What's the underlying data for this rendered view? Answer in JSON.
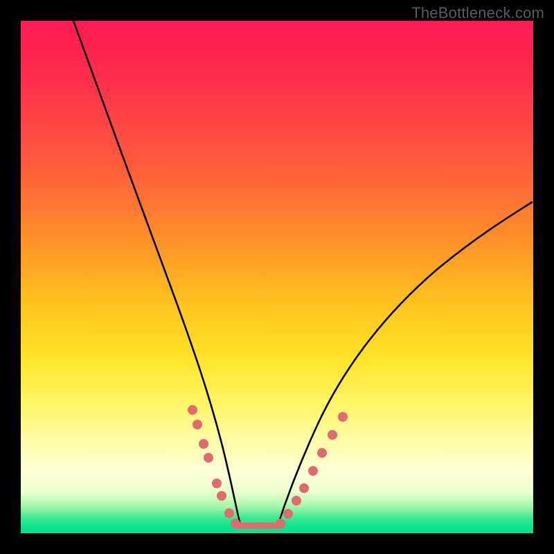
{
  "watermark": {
    "text": "TheBottleneck.com"
  },
  "chart_data": {
    "type": "line",
    "title": "",
    "xlabel": "",
    "ylabel": "",
    "xlim": [
      0,
      100
    ],
    "ylim": [
      0,
      100
    ],
    "grid": false,
    "legend": false,
    "curves": [
      {
        "name": "left",
        "x": [
          0,
          5,
          10,
          15,
          20,
          25,
          28,
          30,
          32,
          34,
          36,
          38,
          40,
          41,
          42
        ],
        "y": [
          100,
          90,
          79,
          67,
          55,
          42,
          33,
          27,
          21,
          16,
          11,
          7,
          3,
          1.5,
          0.5
        ]
      },
      {
        "name": "bottom",
        "x": [
          42,
          44,
          46,
          48,
          50
        ],
        "y": [
          0.5,
          0.3,
          0.3,
          0.3,
          0.5
        ]
      },
      {
        "name": "right",
        "x": [
          50,
          52,
          55,
          58,
          62,
          67,
          73,
          80,
          88,
          96,
          100
        ],
        "y": [
          0.5,
          2,
          6,
          11,
          18,
          26,
          34,
          42,
          49,
          54,
          56
        ]
      }
    ],
    "markers_left": {
      "name": "left-series-points",
      "color": "#e06a6d",
      "points": [
        {
          "x": 33.2,
          "y": 24.0
        },
        {
          "x": 34.2,
          "y": 21.0
        },
        {
          "x": 35.5,
          "y": 17.5
        },
        {
          "x": 36.4,
          "y": 15.0
        },
        {
          "x": 38.0,
          "y": 10.0
        },
        {
          "x": 39.0,
          "y": 7.5
        },
        {
          "x": 40.5,
          "y": 4.0
        },
        {
          "x": 41.6,
          "y": 1.8
        }
      ]
    },
    "markers_right": {
      "name": "right-series-points",
      "color": "#e06a6d",
      "points": [
        {
          "x": 50.5,
          "y": 1.5
        },
        {
          "x": 52.0,
          "y": 3.5
        },
        {
          "x": 53.5,
          "y": 6.0
        },
        {
          "x": 55.0,
          "y": 8.5
        },
        {
          "x": 56.8,
          "y": 12.0
        },
        {
          "x": 58.5,
          "y": 15.5
        },
        {
          "x": 60.5,
          "y": 19.0
        },
        {
          "x": 62.5,
          "y": 22.5
        }
      ]
    },
    "marker_bridge": {
      "name": "bottom-bridge",
      "color": "#e06a6d",
      "x": [
        41.6,
        50.5
      ],
      "y": [
        1.4,
        1.4
      ],
      "stroke_width": 8
    },
    "gradient_stops": [
      {
        "pos": 0.0,
        "color": "#ff1a52"
      },
      {
        "pos": 0.28,
        "color": "#ff5a3c"
      },
      {
        "pos": 0.55,
        "color": "#ffc21e"
      },
      {
        "pos": 0.82,
        "color": "#fffca8"
      },
      {
        "pos": 0.95,
        "color": "#9cf6a6"
      },
      {
        "pos": 1.0,
        "color": "#00e090"
      }
    ]
  }
}
